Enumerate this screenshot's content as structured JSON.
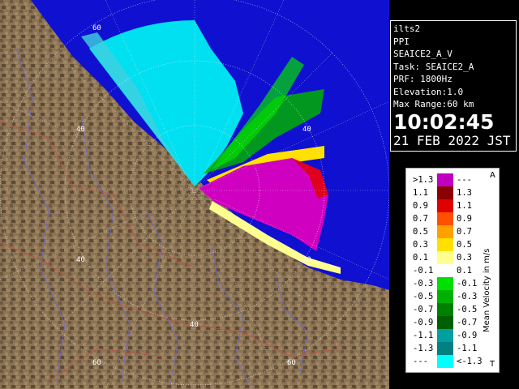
{
  "info": {
    "site": "ilts2",
    "product": "PPI",
    "volume": "SEAICE2_A_V",
    "task": "Task: SEAICE2_A",
    "prf": "PRF: 1800Hz",
    "elevation": "Elevation:1.0",
    "max_range": "Max Range:60 km",
    "time": "10:02:45",
    "date": "21 FEB 2022 JST"
  },
  "range_labels": [
    "60",
    "40",
    "40",
    "40",
    "60",
    "40",
    "40",
    "60"
  ],
  "legend": {
    "title": "Mean Velocity in m/s",
    "corner_top": "A",
    "corner_bottom": "T",
    "rows": [
      {
        "lo": ">1.3",
        "hi": "---",
        "color": "#c000c0"
      },
      {
        "lo": "1.1",
        "hi": "1.3",
        "color": "#8b0000"
      },
      {
        "lo": "0.9",
        "hi": "1.1",
        "color": "#e00000"
      },
      {
        "lo": "0.7",
        "hi": "0.9",
        "color": "#ff5000"
      },
      {
        "lo": "0.5",
        "hi": "0.7",
        "color": "#ffa000"
      },
      {
        "lo": "0.3",
        "hi": "0.5",
        "color": "#ffe000"
      },
      {
        "lo": "0.1",
        "hi": "0.3",
        "color": "#ffff90"
      },
      {
        "lo": "-0.1",
        "hi": "0.1",
        "color": "#ffffff"
      },
      {
        "lo": "-0.3",
        "hi": "-0.1",
        "color": "#00e000"
      },
      {
        "lo": "-0.5",
        "hi": "-0.3",
        "color": "#00b000"
      },
      {
        "lo": "-0.7",
        "hi": "-0.5",
        "color": "#008000"
      },
      {
        "lo": "-0.9",
        "hi": "-0.7",
        "color": "#006000"
      },
      {
        "lo": "-1.1",
        "hi": "-0.9",
        "color": "#00a0a0"
      },
      {
        "lo": "-1.3",
        "hi": "-1.1",
        "color": "#008080"
      },
      {
        "lo": "---",
        "hi": "<-1.3",
        "color": "#00ffff"
      }
    ]
  },
  "colors": {
    "sea": "#1010d0",
    "land": "#8b7355",
    "approach": "#00e0f0",
    "recede": "#d000c0"
  }
}
